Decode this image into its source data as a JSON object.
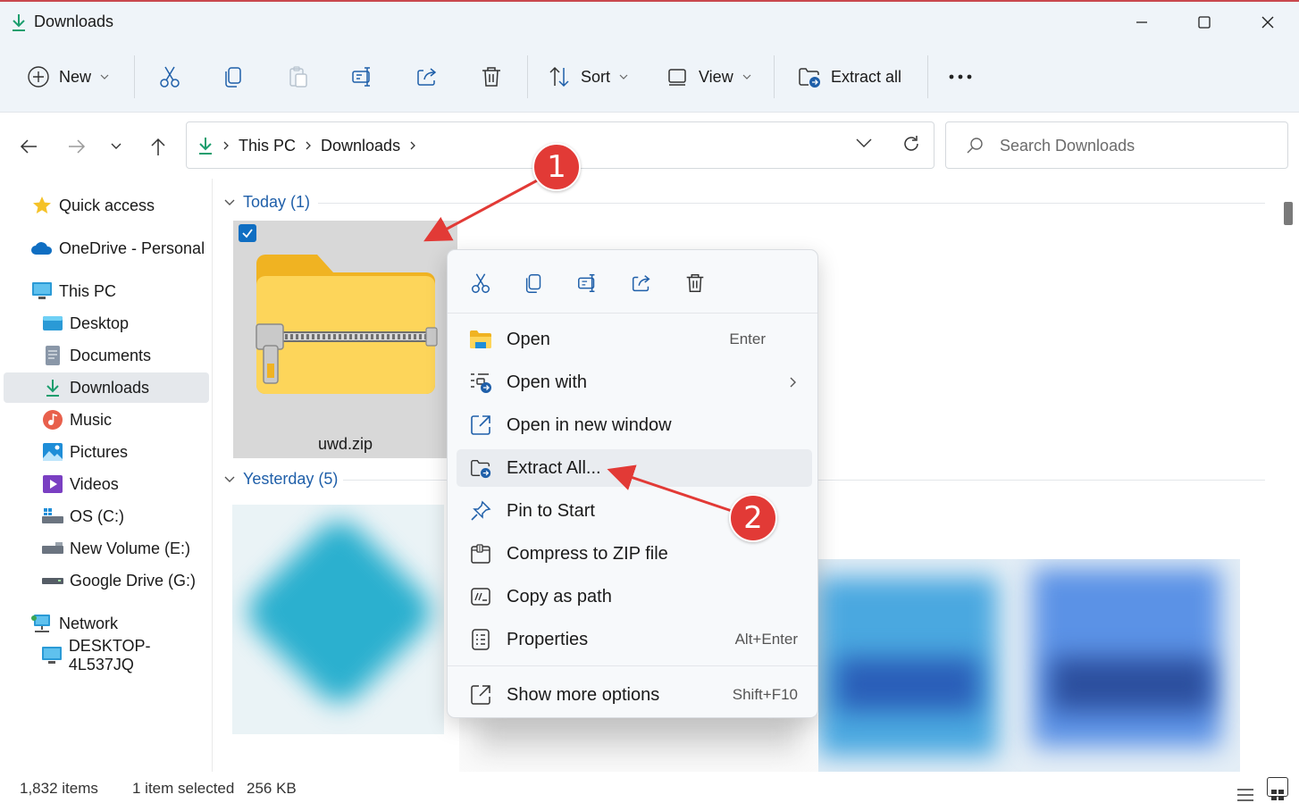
{
  "window": {
    "title": "Downloads",
    "icons": {
      "app": "download-arrow-icon",
      "minimize": "minimize-icon",
      "maximize": "maximize-icon",
      "close": "close-icon"
    }
  },
  "toolbar": {
    "new_label": "New",
    "sort_label": "Sort",
    "view_label": "View",
    "extract_all_label": "Extract all",
    "icons": [
      "plus-circle-icon",
      "cut-icon",
      "copy-icon",
      "paste-icon",
      "rename-icon",
      "share-icon",
      "delete-icon",
      "sort-icon",
      "view-icon",
      "extract-icon",
      "more-icon"
    ]
  },
  "nav": {
    "breadcrumbs": [
      "This PC",
      "Downloads"
    ],
    "search_placeholder": "Search Downloads"
  },
  "sidebar": {
    "items": [
      {
        "label": "Quick access",
        "icon": "star-icon"
      },
      {
        "label": "OneDrive - Personal",
        "icon": "cloud-icon"
      },
      {
        "label": "This PC",
        "icon": "monitor-icon"
      },
      {
        "label": "Desktop",
        "icon": "desktop-folder-icon"
      },
      {
        "label": "Documents",
        "icon": "documents-icon"
      },
      {
        "label": "Downloads",
        "icon": "download-arrow-icon",
        "selected": true
      },
      {
        "label": "Music",
        "icon": "music-icon"
      },
      {
        "label": "Pictures",
        "icon": "pictures-icon"
      },
      {
        "label": "Videos",
        "icon": "videos-icon"
      },
      {
        "label": "OS (C:)",
        "icon": "drive-c-icon"
      },
      {
        "label": "New Volume (E:)",
        "icon": "drive-icon"
      },
      {
        "label": "Google Drive (G:)",
        "icon": "drive-icon"
      },
      {
        "label": "Network",
        "icon": "network-icon"
      },
      {
        "label": "DESKTOP-4L537JQ",
        "icon": "computer-icon"
      }
    ]
  },
  "content": {
    "groups": [
      {
        "label": "Today (1)"
      },
      {
        "label": "Yesterday (5)"
      }
    ],
    "selected_file": {
      "name": "uwd.zip",
      "icon": "zip-folder-icon",
      "checked": true
    }
  },
  "status": {
    "items": "1,832 items",
    "selection": "1 item selected",
    "size": "256 KB"
  },
  "context_menu": {
    "quick_actions": [
      "cut-icon",
      "copy-icon",
      "rename-icon",
      "share-icon",
      "delete-icon"
    ],
    "items": [
      {
        "label": "Open",
        "shortcut": "Enter",
        "icon": "folder-open-icon"
      },
      {
        "label": "Open with",
        "shortcut": "",
        "icon": "open-with-icon",
        "submenu": true
      },
      {
        "label": "Open in new window",
        "shortcut": "",
        "icon": "new-window-icon"
      },
      {
        "label": "Extract All...",
        "shortcut": "",
        "icon": "extract-icon",
        "highlighted": true
      },
      {
        "label": "Pin to Start",
        "shortcut": "",
        "icon": "pin-icon"
      },
      {
        "label": "Compress to ZIP file",
        "shortcut": "",
        "icon": "zip-icon"
      },
      {
        "label": "Copy as path",
        "shortcut": "",
        "icon": "copy-path-icon"
      },
      {
        "label": "Properties",
        "shortcut": "Alt+Enter",
        "icon": "properties-icon"
      },
      {
        "label": "Show more options",
        "shortcut": "Shift+F10",
        "icon": "more-options-icon"
      }
    ]
  },
  "annotations": {
    "badges": [
      "1",
      "2"
    ],
    "color": "#e23a36"
  },
  "colors": {
    "accent": "#0f6ec2",
    "group_header": "#1f5fa9",
    "chrome_bg": "#eff4f9"
  }
}
